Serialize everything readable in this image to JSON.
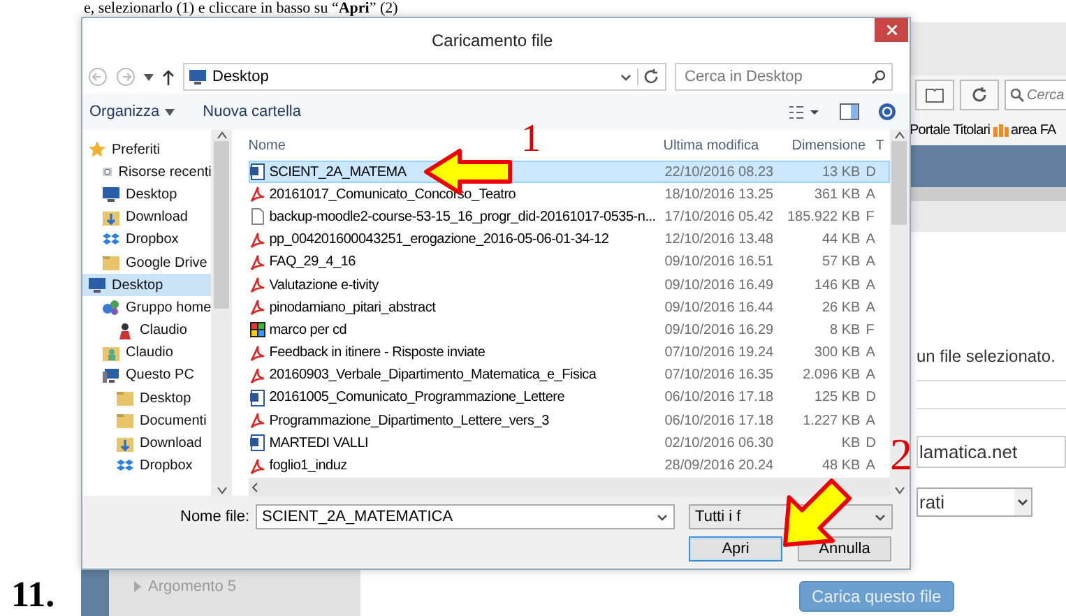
{
  "instruction": "e, selezionarlo (1) e cliccare in basso su “**Apri**” (2)",
  "step_number": "11.",
  "dialog": {
    "title": "Caricamento file",
    "address": "Desktop",
    "search": {
      "placeholder": "Cerca in Desktop"
    },
    "toolbar": [
      "Organizza",
      "Nuova cartella"
    ],
    "sidebar": [
      {
        "label": "Preferiti",
        "kind": "star",
        "selected": false,
        "children": [
          {
            "label": "Risorse recenti",
            "kind": "recent",
            "selected": false
          },
          {
            "label": "Desktop",
            "kind": "monitor",
            "selected": false
          },
          {
            "label": "Download",
            "kind": "download",
            "selected": false
          },
          {
            "label": "Dropbox",
            "kind": "dropbox",
            "selected": false
          },
          {
            "label": "Google Drive",
            "kind": "folder",
            "selected": false
          }
        ]
      },
      {
        "label": "Desktop",
        "kind": "monitor",
        "selected": true,
        "children": [
          {
            "label": "Gruppo home",
            "kind": "network",
            "selected": false,
            "children": [
              {
                "label": "Claudio",
                "kind": "person",
                "selected": false
              }
            ]
          },
          {
            "label": "Claudio",
            "kind": "userfolder",
            "selected": false
          },
          {
            "label": "Questo PC",
            "kind": "pc",
            "selected": false,
            "children": [
              {
                "label": "Desktop",
                "kind": "folder",
                "selected": false
              },
              {
                "label": "Documenti",
                "kind": "folder",
                "selected": false
              },
              {
                "label": "Download",
                "kind": "download",
                "selected": false
              },
              {
                "label": "Dropbox",
                "kind": "dropbox",
                "selected": false
              }
            ]
          }
        ]
      }
    ],
    "columns": [
      "Nome",
      "Ultima modifica",
      "Dimensione",
      "T"
    ],
    "files": [
      {
        "name": "SCIENT_2A_MATEMA",
        "date": "22/10/2016 08.23",
        "size": "13 KB",
        "type": "D",
        "kind": "word",
        "selected": true
      },
      {
        "name": "20161017_Comunicato_Concorso_Teatro",
        "date": "18/10/2016 13.25",
        "size": "361 KB",
        "type": "A",
        "kind": "pdf",
        "selected": false
      },
      {
        "name": "backup-moodle2-course-53-15_16_progr_did-20161017-0535-n...",
        "date": "17/10/2016 05.42",
        "size": "185.922 KB",
        "type": "F",
        "kind": "blank",
        "selected": false
      },
      {
        "name": "pp_004201600043251_erogazione_2016-05-06-01-34-12",
        "date": "12/10/2016 13.48",
        "size": "44 KB",
        "type": "A",
        "kind": "pdf",
        "selected": false
      },
      {
        "name": "FAQ_29_4_16",
        "date": "09/10/2016 16.51",
        "size": "57 KB",
        "type": "A",
        "kind": "pdf",
        "selected": false
      },
      {
        "name": "Valutazione e-tivity",
        "date": "09/10/2016 16.49",
        "size": "146 KB",
        "type": "A",
        "kind": "pdf",
        "selected": false
      },
      {
        "name": "pinodamiano_pitari_abstract",
        "date": "09/10/2016 16.44",
        "size": "26 KB",
        "type": "A",
        "kind": "pdf",
        "selected": false
      },
      {
        "name": "marco per cd",
        "date": "09/10/2016 16.29",
        "size": "8 KB",
        "type": "F",
        "kind": "image",
        "selected": false
      },
      {
        "name": "Feedback in itinere - Risposte inviate",
        "date": "07/10/2016 19.24",
        "size": "300 KB",
        "type": "A",
        "kind": "pdf",
        "selected": false
      },
      {
        "name": "20160903_Verbale_Dipartimento_Matematica_e_Fisica",
        "date": "07/10/2016 16.35",
        "size": "2.096 KB",
        "type": "A",
        "kind": "pdf",
        "selected": false
      },
      {
        "name": "20161005_Comunicato_Programmazione_Lettere",
        "date": "06/10/2016 17.18",
        "size": "125 KB",
        "type": "D",
        "kind": "word",
        "selected": false
      },
      {
        "name": "Programmazione_Dipartimento_Lettere_vers_3",
        "date": "06/10/2016 17.18",
        "size": "1.227 KB",
        "type": "A",
        "kind": "pdf",
        "selected": false
      },
      {
        "name": "MARTEDI VALLI",
        "date": "02/10/2016 06.30",
        "size": "KB",
        "type": "D",
        "kind": "word",
        "selected": false
      },
      {
        "name": "foglio1_induz",
        "date": "28/09/2016 20.24",
        "size": "48 KB",
        "type": "A",
        "kind": "pdf",
        "selected": false
      }
    ],
    "filename_label": "Nome file:",
    "filename": "SCIENT_2A_MATEMATICA",
    "filter": "Tutti i f",
    "buttons": [
      {
        "label": "Apri",
        "default": true
      },
      {
        "label": "Annulla",
        "default": false
      }
    ]
  },
  "annotations": [
    {
      "number": "1"
    },
    {
      "number": "2"
    }
  ],
  "browser": {
    "search": {
      "placeholder": "Cerca"
    },
    "bookmarks": [
      "Portale Titolari",
      "area FA"
    ],
    "status_text": "un file selezionato.",
    "field_value": "lamatica.net",
    "select_value": "rati",
    "course_item": "Argomento 5",
    "upload_button": "Carica questo file"
  }
}
